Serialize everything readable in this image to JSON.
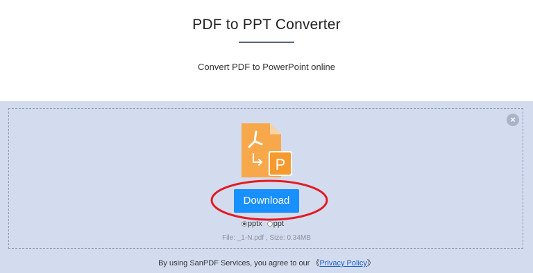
{
  "header": {
    "title": "PDF to PPT Converter",
    "subtitle": "Convert PDF to PowerPoint online"
  },
  "converter": {
    "close_icon": "close-icon",
    "file_icon": "pdf-to-ppt-file-icon",
    "download_label": "Download",
    "formats": [
      {
        "label": "pptx",
        "selected": true
      },
      {
        "label": "ppt",
        "selected": false
      }
    ],
    "file_info": "File: _1-N.pdf , Size: 0.34MB",
    "close_glyph": "×"
  },
  "footer": {
    "terms_prefix": "By using SanPDF Services, you agree to our",
    "bracket_open": "《",
    "privacy_link": "Privacy Policy",
    "bracket_close": "》"
  },
  "colors": {
    "panel_bg": "#d3dcef",
    "download_button": "#1890ff",
    "file_orange": "#f7a84b",
    "annotation_red": "#e31b23"
  }
}
